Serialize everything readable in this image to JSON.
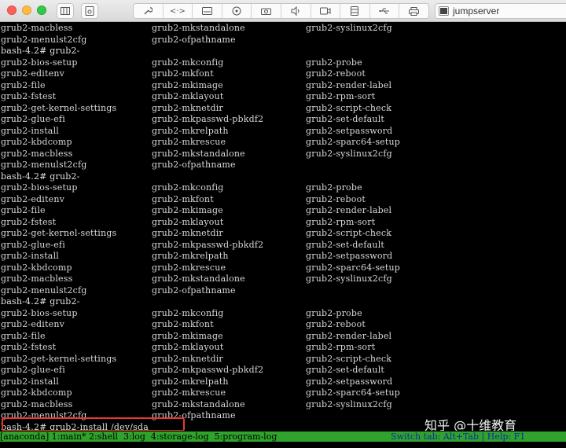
{
  "window": {
    "tab_title": "jumpserver",
    "toolbar_icons": [
      "sidebar-toggle-icon",
      "preferences-icon",
      "wrench-icon",
      "arrows-icon",
      "drive-icon",
      "disk-icon",
      "camera-icon",
      "speaker-icon",
      "video-icon",
      "storage-icon",
      "usb-icon",
      "printer-icon"
    ]
  },
  "terminal": {
    "lines": [
      [
        "grub2-macbless",
        "grub2-mkstandalone",
        "grub2-syslinux2cfg"
      ],
      [
        "grub2-menulst2cfg",
        "grub2-ofpathname",
        ""
      ],
      [
        "bash-4.2# grub2-",
        "",
        ""
      ],
      [
        "grub2-bios-setup",
        "grub2-mkconfig",
        "grub2-probe"
      ],
      [
        "grub2-editenv",
        "grub2-mkfont",
        "grub2-reboot"
      ],
      [
        "grub2-file",
        "grub2-mkimage",
        "grub2-render-label"
      ],
      [
        "grub2-fstest",
        "grub2-mklayout",
        "grub2-rpm-sort"
      ],
      [
        "grub2-get-kernel-settings",
        "grub2-mknetdir",
        "grub2-script-check"
      ],
      [
        "grub2-glue-efi",
        "grub2-mkpasswd-pbkdf2",
        "grub2-set-default"
      ],
      [
        "grub2-install",
        "grub2-mkrelpath",
        "grub2-setpassword"
      ],
      [
        "grub2-kbdcomp",
        "grub2-mkrescue",
        "grub2-sparc64-setup"
      ],
      [
        "grub2-macbless",
        "grub2-mkstandalone",
        "grub2-syslinux2cfg"
      ],
      [
        "grub2-menulst2cfg",
        "grub2-ofpathname",
        ""
      ],
      [
        "bash-4.2# grub2-",
        "",
        ""
      ],
      [
        "grub2-bios-setup",
        "grub2-mkconfig",
        "grub2-probe"
      ],
      [
        "grub2-editenv",
        "grub2-mkfont",
        "grub2-reboot"
      ],
      [
        "grub2-file",
        "grub2-mkimage",
        "grub2-render-label"
      ],
      [
        "grub2-fstest",
        "grub2-mklayout",
        "grub2-rpm-sort"
      ],
      [
        "grub2-get-kernel-settings",
        "grub2-mknetdir",
        "grub2-script-check"
      ],
      [
        "grub2-glue-efi",
        "grub2-mkpasswd-pbkdf2",
        "grub2-set-default"
      ],
      [
        "grub2-install",
        "grub2-mkrelpath",
        "grub2-setpassword"
      ],
      [
        "grub2-kbdcomp",
        "grub2-mkrescue",
        "grub2-sparc64-setup"
      ],
      [
        "grub2-macbless",
        "grub2-mkstandalone",
        "grub2-syslinux2cfg"
      ],
      [
        "grub2-menulst2cfg",
        "grub2-ofpathname",
        ""
      ],
      [
        "bash-4.2# grub2-",
        "",
        ""
      ],
      [
        "grub2-bios-setup",
        "grub2-mkconfig",
        "grub2-probe"
      ],
      [
        "grub2-editenv",
        "grub2-mkfont",
        "grub2-reboot"
      ],
      [
        "grub2-file",
        "grub2-mkimage",
        "grub2-render-label"
      ],
      [
        "grub2-fstest",
        "grub2-mklayout",
        "grub2-rpm-sort"
      ],
      [
        "grub2-get-kernel-settings",
        "grub2-mknetdir",
        "grub2-script-check"
      ],
      [
        "grub2-glue-efi",
        "grub2-mkpasswd-pbkdf2",
        "grub2-set-default"
      ],
      [
        "grub2-install",
        "grub2-mkrelpath",
        "grub2-setpassword"
      ],
      [
        "grub2-kbdcomp",
        "grub2-mkrescue",
        "grub2-sparc64-setup"
      ],
      [
        "grub2-macbless",
        "grub2-mkstandalone",
        "grub2-syslinux2cfg"
      ],
      [
        "grub2-menulst2cfg",
        "grub2-ofpathname",
        ""
      ],
      [
        "bash-4.2# grub2-install /dev/sda",
        "",
        ""
      ]
    ],
    "highlight_color": "#e8392f"
  },
  "statusbar": {
    "left": "[anaconda] 1:main* 2:shell  3:log  4:storage-log  5:program-log",
    "right": "Switch tab: Alt+Tab | Help: F1",
    "background": "#2fa32b"
  },
  "watermark": "知乎 @十维教育"
}
